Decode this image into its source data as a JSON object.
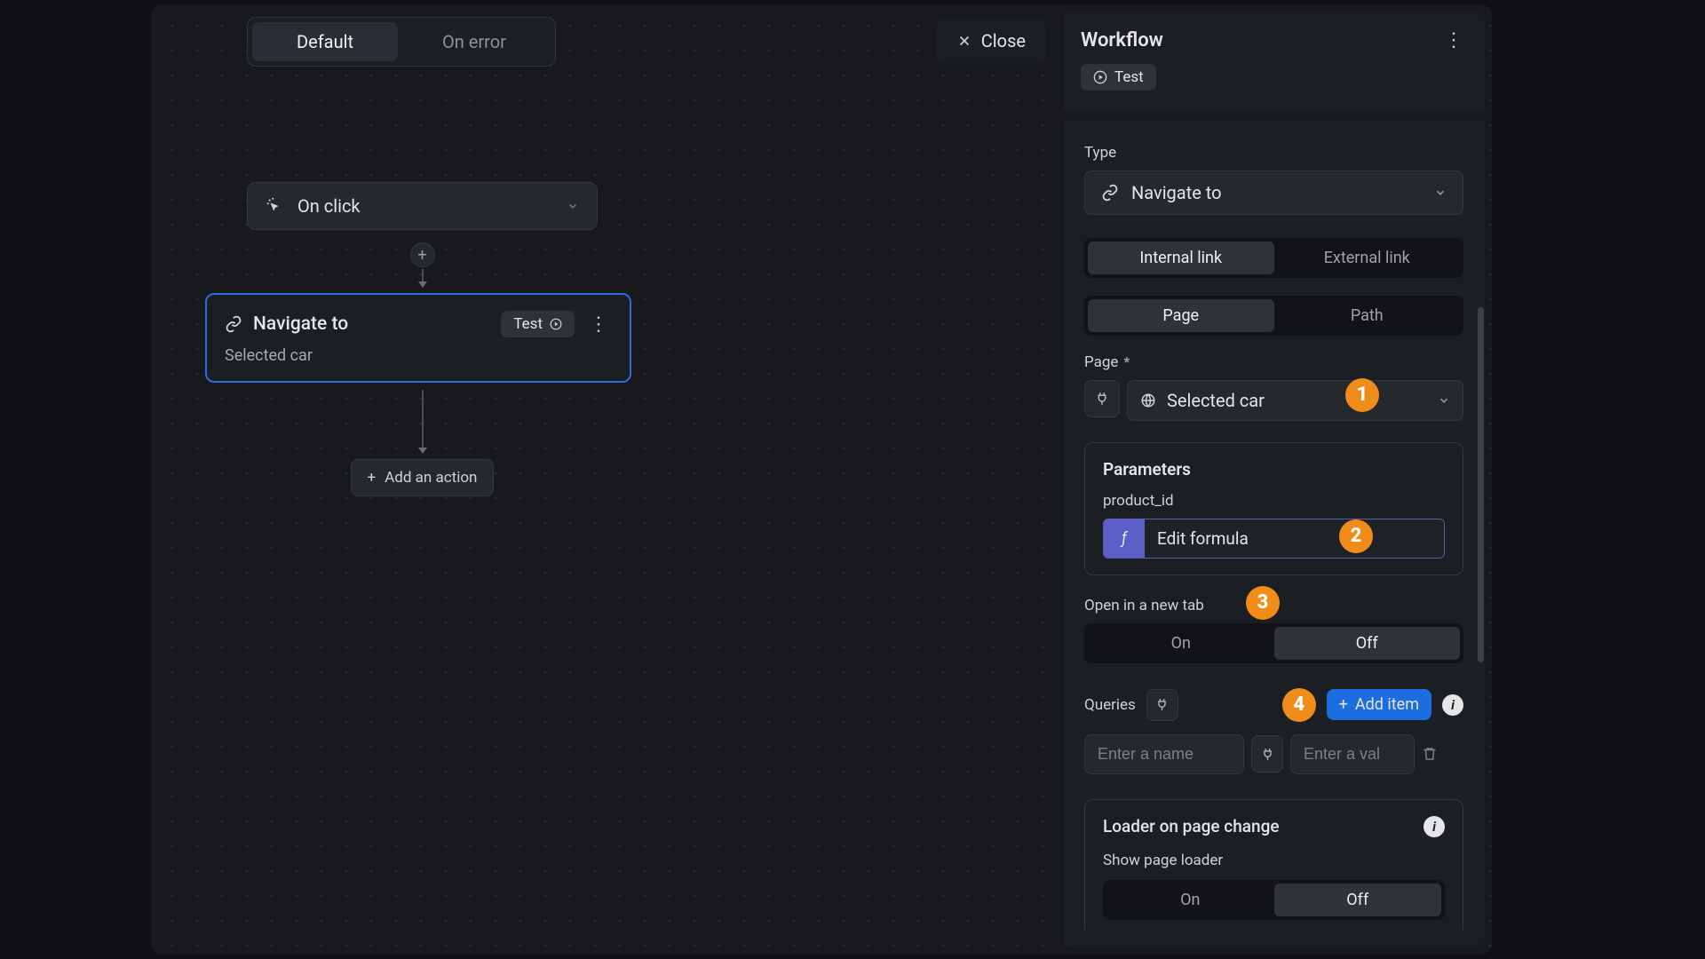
{
  "tabs": {
    "default": "Default",
    "onError": "On error"
  },
  "close": "Close",
  "trigger": {
    "label": "On click"
  },
  "addActionLabel": "Add an action",
  "actionCard": {
    "icon": "link",
    "title": "Navigate to",
    "test": "Test",
    "subtitle": "Selected car"
  },
  "panel": {
    "title": "Workflow",
    "test": "Test",
    "type": {
      "label": "Type",
      "value": "Navigate to"
    },
    "linkMode": {
      "internal": "Internal link",
      "external": "External link"
    },
    "target": {
      "page": "Page",
      "path": "Path"
    },
    "pageField": {
      "label": "Page",
      "required": "*",
      "value": "Selected car"
    },
    "params": {
      "title": "Parameters",
      "paramName": "product_id",
      "formulaLabel": "Edit formula"
    },
    "newTab": {
      "label": "Open in a new tab",
      "on": "On",
      "off": "Off"
    },
    "queries": {
      "label": "Queries",
      "addItem": "Add item",
      "namePlaceholder": "Enter a name",
      "valuePlaceholder": "Enter a val"
    },
    "loader": {
      "title": "Loader on page change",
      "sublabel": "Show page loader",
      "on": "On",
      "off": "Off"
    }
  },
  "badges": {
    "b1": "1",
    "b2": "2",
    "b3": "3",
    "b4": "4"
  }
}
